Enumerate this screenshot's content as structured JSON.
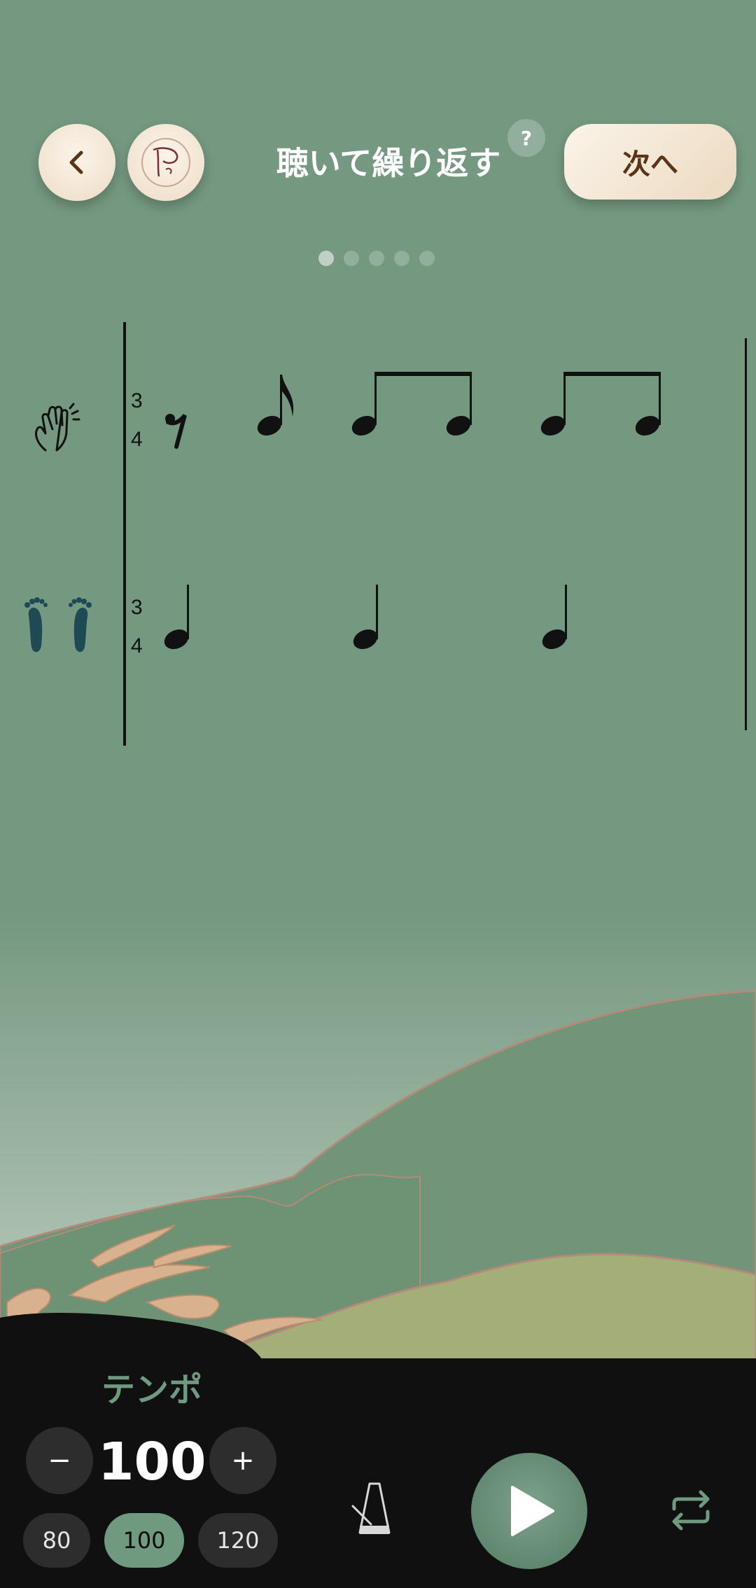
{
  "header": {
    "back_icon": "chevron-left-icon",
    "profile_icon": "note-p-icon",
    "title": "聴いて繰り返す",
    "help_label": "?",
    "next_label": "次へ"
  },
  "pagination": {
    "total": 5,
    "current": 1
  },
  "score": {
    "time_signature": {
      "top": "3",
      "bottom": "4"
    },
    "rows": [
      {
        "icon": "clapping-hands-icon",
        "notes": [
          "eighth-rest",
          "eighth",
          "eighth",
          "eighth",
          "eighth",
          "eighth"
        ]
      },
      {
        "icon": "feet-icon",
        "notes": [
          "quarter",
          "quarter",
          "quarter"
        ]
      }
    ]
  },
  "tempo": {
    "label": "テンポ",
    "minus_label": "−",
    "plus_label": "+",
    "value": "100",
    "presets": [
      "80",
      "100",
      "120"
    ],
    "selected_preset": "100"
  },
  "controls": {
    "metronome_icon": "metronome-icon",
    "play_icon": "play-icon",
    "repeat_icon": "repeat-icon"
  },
  "colors": {
    "background": "#749880",
    "accent": "#6f9a80",
    "button_cream": "#f5e9da",
    "panel": "#101010"
  }
}
